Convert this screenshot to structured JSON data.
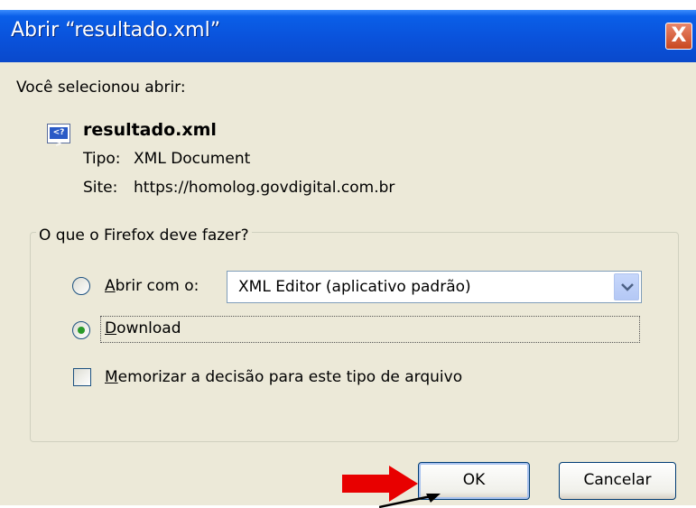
{
  "window": {
    "title": "Abrir “resultado.xml”",
    "close_label": "X"
  },
  "intro": "Você selecionou abrir:",
  "file": {
    "name": "resultado.xml",
    "icon": "xml-file-icon",
    "type_label": "Tipo:",
    "type_value": "XML Document",
    "site_label": "Site:",
    "site_value": "https://homolog.govdigital.com.br"
  },
  "group": {
    "legend": "O que o Firefox deve fazer?",
    "open_with": {
      "label_accel": "A",
      "label_rest": "brir com o:",
      "selected": false,
      "app_value": "XML Editor (aplicativo padrão)"
    },
    "download": {
      "label_accel": "D",
      "label_rest": "ownload",
      "selected": true
    },
    "remember": {
      "label_accel": "M",
      "label_rest": "emorizar a decisão para este tipo de arquivo",
      "checked": false
    }
  },
  "buttons": {
    "ok": "OK",
    "cancel": "Cancelar"
  },
  "colors": {
    "dialog_bg": "#ece9d8",
    "titlebar": "#0a52db",
    "annotation_arrow": "#e80000"
  }
}
